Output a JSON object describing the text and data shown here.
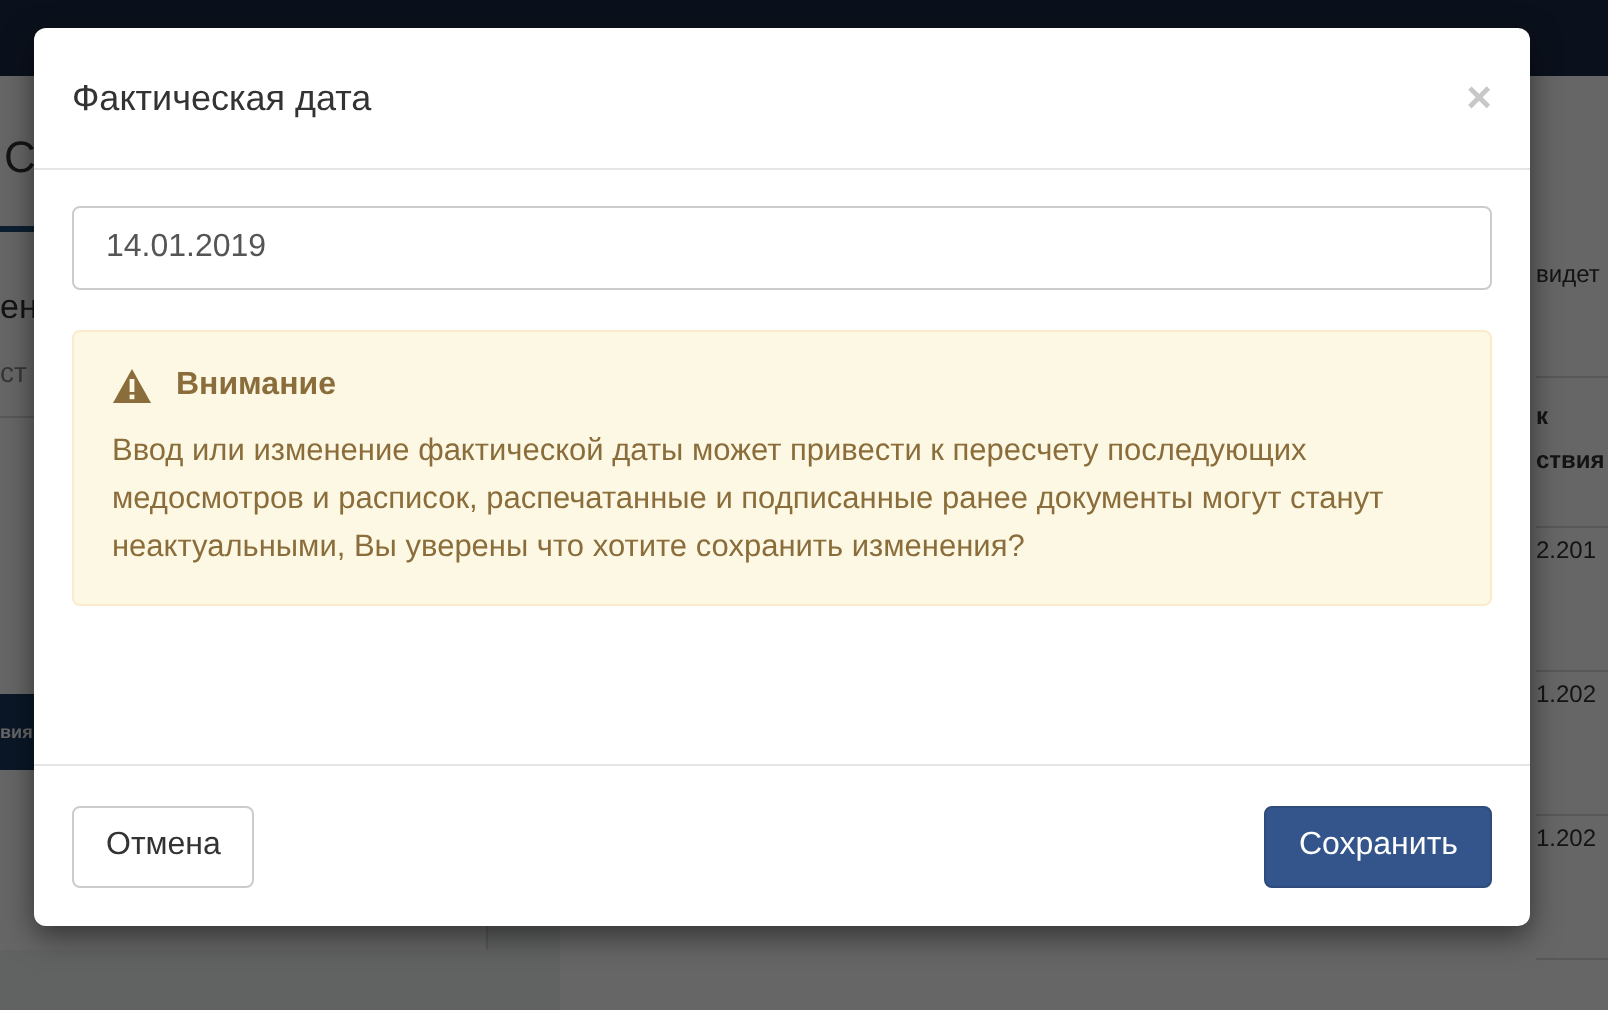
{
  "background_page": {
    "left_fragments": [
      {
        "kind": "tab",
        "text": "С"
      },
      {
        "kind": "heading",
        "text": "ен"
      },
      {
        "kind": "column",
        "text": "ст"
      },
      {
        "kind": "button",
        "text": "вия"
      }
    ],
    "right_fragments": [
      {
        "kind": "tab",
        "text": "видет"
      },
      {
        "kind": "header",
        "text": "к"
      },
      {
        "kind": "header",
        "text": "ствия"
      },
      {
        "kind": "cell",
        "text": "2.201"
      },
      {
        "kind": "cell",
        "text": "1.202"
      },
      {
        "kind": "cell",
        "text": "1.202"
      }
    ]
  },
  "dialog": {
    "title": "Фактическая дата",
    "close": "×",
    "date_field": {
      "value": "14.01.2019"
    },
    "alert": {
      "title": "Внимание",
      "message": "Ввод или изменение фактической даты может привести к пересчету последующих медосмотров и расписок, распечатанные и подписанные ранее документы могут станут неактуальными, Вы уверены что хотите сохранить изменения?"
    },
    "buttons": [
      {
        "kind": "default",
        "label": "Отмена"
      },
      {
        "kind": "primary",
        "label": "Сохранить"
      }
    ]
  }
}
